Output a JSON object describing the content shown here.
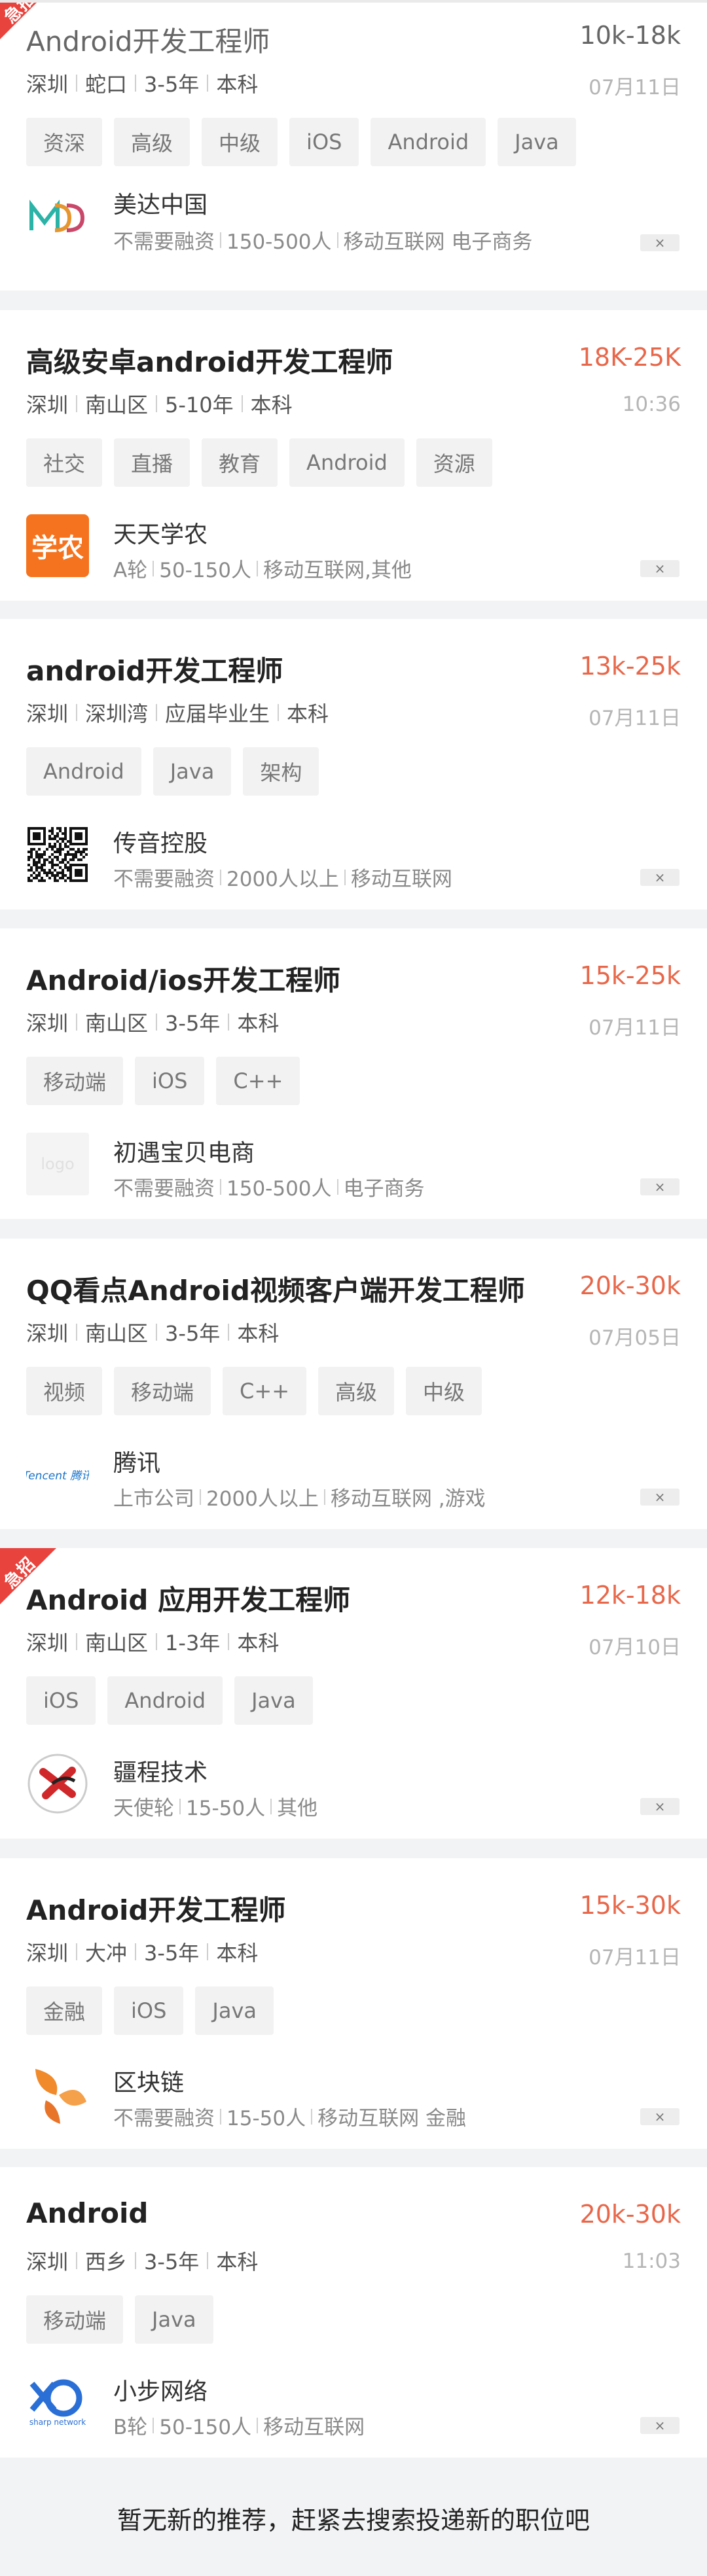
{
  "jobs": [
    {
      "title": "Android开发工程师",
      "salary": "10k-18k",
      "dim": true,
      "urgent": true,
      "urgent_label": "急招",
      "meta": [
        "深圳",
        "蛇口",
        "3-5年",
        "本科"
      ],
      "date": "07月11日",
      "tags": [
        "资深",
        "高级",
        "中级",
        "iOS",
        "Android",
        "Java"
      ],
      "company": "美达中国",
      "company_info": [
        "不需要融资",
        "150-500人",
        "移动互联网 电子商务"
      ],
      "logo": "mdd"
    },
    {
      "title": "高级安卓android开发工程师",
      "salary": "18K-25K",
      "dim": false,
      "urgent": false,
      "meta": [
        "深圳",
        "南山区",
        "5-10年",
        "本科"
      ],
      "date": "10:36",
      "tags": [
        "社交",
        "直播",
        "教育",
        "Android",
        "资源"
      ],
      "company": "天天学农",
      "company_info": [
        "A轮",
        "50-150人",
        "移动互联网,其他"
      ],
      "logo": "xuenong",
      "logo_text": "学农"
    },
    {
      "title": "android开发工程师",
      "salary": "13k-25k",
      "dim": false,
      "urgent": false,
      "meta": [
        "深圳",
        "深圳湾",
        "应届毕业生",
        "本科"
      ],
      "date": "07月11日",
      "tags": [
        "Android",
        "Java",
        "架构"
      ],
      "company": "传音控股",
      "company_info": [
        "不需要融资",
        "2000人以上",
        "移动互联网"
      ],
      "logo": "qr"
    },
    {
      "title": "Android/ios开发工程师",
      "salary": "15k-25k",
      "dim": false,
      "urgent": false,
      "meta": [
        "深圳",
        "南山区",
        "3-5年",
        "本科"
      ],
      "date": "07月11日",
      "tags": [
        "移动端",
        "iOS",
        "C++"
      ],
      "company": "初遇宝贝电商",
      "company_info": [
        "不需要融资",
        "150-500人",
        "电子商务"
      ],
      "logo": "placeholder",
      "logo_text": "logo"
    },
    {
      "title": "QQ看点Android视频客户端开发工程师",
      "salary": "20k-30k",
      "dim": false,
      "urgent": false,
      "meta": [
        "深圳",
        "南山区",
        "3-5年",
        "本科"
      ],
      "date": "07月05日",
      "tags": [
        "视频",
        "移动端",
        "C++",
        "高级",
        "中级"
      ],
      "company": "腾讯",
      "company_info": [
        "上市公司",
        "2000人以上",
        "移动互联网 ,游戏"
      ],
      "logo": "tencent",
      "logo_text": "Tencent 腾讯"
    },
    {
      "title": "Android 应用开发工程师",
      "salary": "12k-18k",
      "dim": false,
      "urgent": true,
      "urgent_label": "急招",
      "meta": [
        "深圳",
        "南山区",
        "1-3年",
        "本科"
      ],
      "date": "07月10日",
      "tags": [
        "iOS",
        "Android",
        "Java"
      ],
      "company": "疆程技术",
      "company_info": [
        "天使轮",
        "15-50人",
        "其他"
      ],
      "logo": "jiangcheng"
    },
    {
      "title": "Android开发工程师",
      "salary": "15k-30k",
      "dim": false,
      "urgent": false,
      "meta": [
        "深圳",
        "大冲",
        "3-5年",
        "本科"
      ],
      "date": "07月11日",
      "tags": [
        "金融",
        "iOS",
        "Java"
      ],
      "company": "区块链",
      "company_info": [
        "不需要融资",
        "15-50人",
        "移动互联网 金融"
      ],
      "logo": "blockchain"
    },
    {
      "title": "Android",
      "salary": "20k-30k",
      "dim": false,
      "urgent": false,
      "meta": [
        "深圳",
        "西乡",
        "3-5年",
        "本科"
      ],
      "date": "11:03",
      "tags": [
        "移动端",
        "Java"
      ],
      "company": "小步网络",
      "company_info": [
        "B轮",
        "50-150人",
        "移动互联网"
      ],
      "logo": "sharp",
      "logo_text": "sharp network"
    }
  ],
  "close_label": "×",
  "footer_text": "暂无新的推荐，赶紧去搜索投递新的职位吧",
  "colors": {
    "accent": "#e8674a",
    "urgent": "#e8433d",
    "tencent": "#1a73c8",
    "xuenong": "#f5731e"
  }
}
